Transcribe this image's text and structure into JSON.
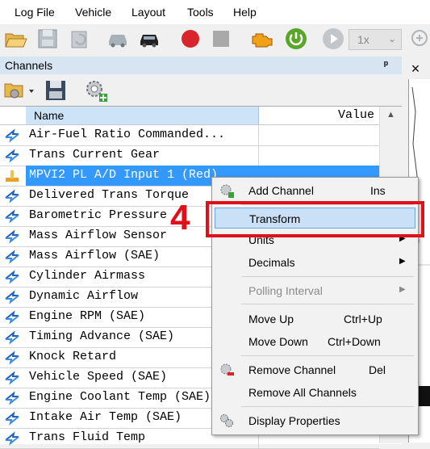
{
  "menu": [
    "Log File",
    "Vehicle",
    "Layout",
    "Tools",
    "Help"
  ],
  "toolbar": {
    "speed_value": "1x"
  },
  "panel": {
    "title": "Channels",
    "close_glyph": "×",
    "pin_glyph": "ᵖ"
  },
  "grid": {
    "columns": {
      "name": "Name",
      "value": "Value"
    },
    "rows": [
      "Air-Fuel Ratio Commanded...",
      "Trans Current Gear",
      "MPVI2 PL A/D Input 1 (Red)",
      "Delivered Trans Torque",
      "Barometric Pressure",
      "Mass Airflow Sensor",
      "Mass Airflow (SAE)",
      "Cylinder Airmass",
      "Dynamic Airflow",
      "Engine RPM (SAE)",
      "Timing Advance (SAE)",
      "Knock Retard",
      "Vehicle Speed (SAE)",
      "Engine Coolant Temp (SAE)",
      "Intake Air Temp (SAE)",
      "Trans Fluid Temp"
    ],
    "selected_row": "MPVI2 PL A/D Input 1 (Red)"
  },
  "context_menu": {
    "add_channel": {
      "label": "Add Channel",
      "shortcut": "Ins"
    },
    "transform": {
      "label": "Transform"
    },
    "units": {
      "label": "Units"
    },
    "decimals": {
      "label": "Decimals"
    },
    "polling_interval": {
      "label": "Polling Interval"
    },
    "move_up": {
      "label": "Move Up",
      "shortcut": "Ctrl+Up"
    },
    "move_down": {
      "label": "Move Down",
      "shortcut": "Ctrl+Down"
    },
    "remove_channel": {
      "label": "Remove Channel",
      "shortcut": "Del"
    },
    "remove_all": {
      "label": "Remove All Channels"
    },
    "display_properties": {
      "label": "Display Properties"
    }
  },
  "annotation": {
    "step": "4",
    "color": "#e0101a"
  },
  "colors": {
    "selection": "#3399ff",
    "highlight": "#c9e0f7",
    "header": "#cde3f7"
  }
}
